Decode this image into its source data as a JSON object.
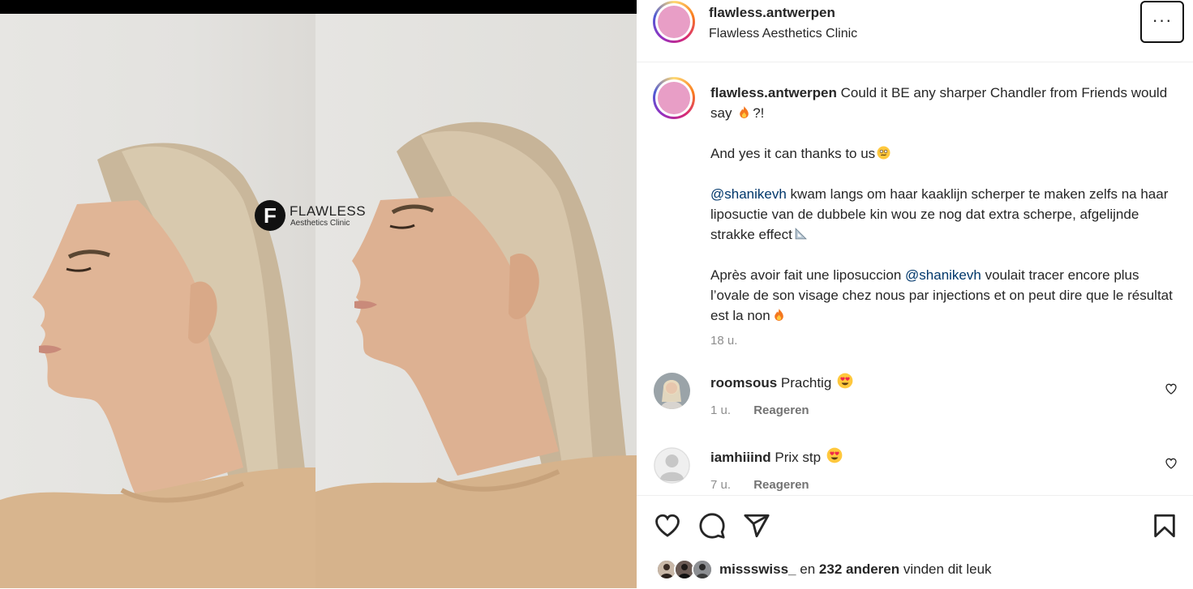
{
  "post": {
    "account": "flawless.antwerpen",
    "account_subtitle": "Flawless Aesthetics Clinic",
    "more_label": "···",
    "watermark": {
      "letter": "F",
      "title": "FLAWLESS",
      "subtitle": "Aesthetics Clinic"
    }
  },
  "caption": {
    "username": "flawless.antwerpen",
    "line1": "Could it BE any sharper Chandler from Friends would say",
    "line1_end": "?!",
    "para2": "And yes it can thanks to us",
    "para3_mention": "@shanikevh",
    "para3_text": "kwam langs om haar kaaklijn scherper te maken zelfs na haar liposuctie van de dubbele kin wou ze nog dat extra scherpe, afgelijnde strakke effect",
    "para4_start": "Après avoir fait une liposuccion",
    "para4_mention": "@shanikevh",
    "para4_text": "voulait tracer encore plus l’ovale de son visage chez nous par injections et on peut dire que le résultat est la non",
    "time": "18 u."
  },
  "comments": [
    {
      "username": "roomsous",
      "text": "Prachtig",
      "time": "1 u.",
      "reply_label": "Reageren"
    },
    {
      "username": "iamhiiind",
      "text": "Prix stp",
      "time": "7 u.",
      "reply_label": "Reageren"
    }
  ],
  "likes": {
    "first_liker": "missswiss_",
    "connector": "en",
    "others": "232 anderen",
    "suffix": "vinden dit leuk"
  },
  "icons": [
    "heart-icon",
    "comment-icon",
    "share-icon",
    "bookmark-icon",
    "more-icon",
    "fire-emoji",
    "heart-eyes-emoji",
    "triangular-ruler-emoji",
    "face-emoji"
  ],
  "colors": {
    "mention": "#00376b",
    "muted": "#8e8e8e",
    "story_ring": [
      "#feda75",
      "#fa7e1e",
      "#d62976",
      "#962fbf",
      "#4f5bd5"
    ],
    "brand_avatar": "#e89ec6"
  }
}
